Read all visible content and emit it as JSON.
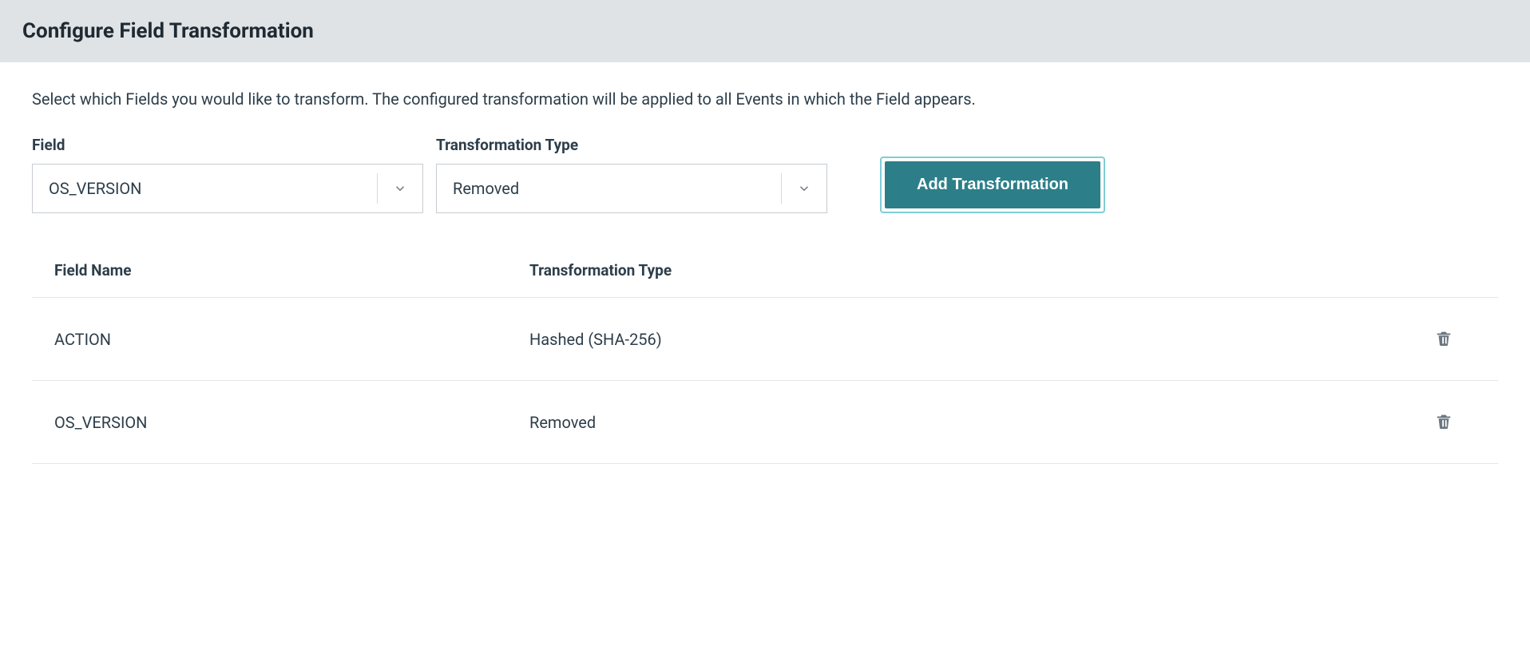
{
  "header": {
    "title": "Configure Field Transformation"
  },
  "description": "Select which Fields you would like to transform. The configured transformation will be applied to all Events in which the Field appears.",
  "form": {
    "field_label": "Field",
    "field_value": "OS_VERSION",
    "type_label": "Transformation Type",
    "type_value": "Removed",
    "add_button": "Add Transformation"
  },
  "table": {
    "headers": {
      "field_name": "Field Name",
      "transformation_type": "Transformation Type"
    },
    "rows": [
      {
        "field_name": "ACTION",
        "transformation_type": "Hashed (SHA-256)"
      },
      {
        "field_name": "OS_VERSION",
        "transformation_type": "Removed"
      }
    ]
  }
}
